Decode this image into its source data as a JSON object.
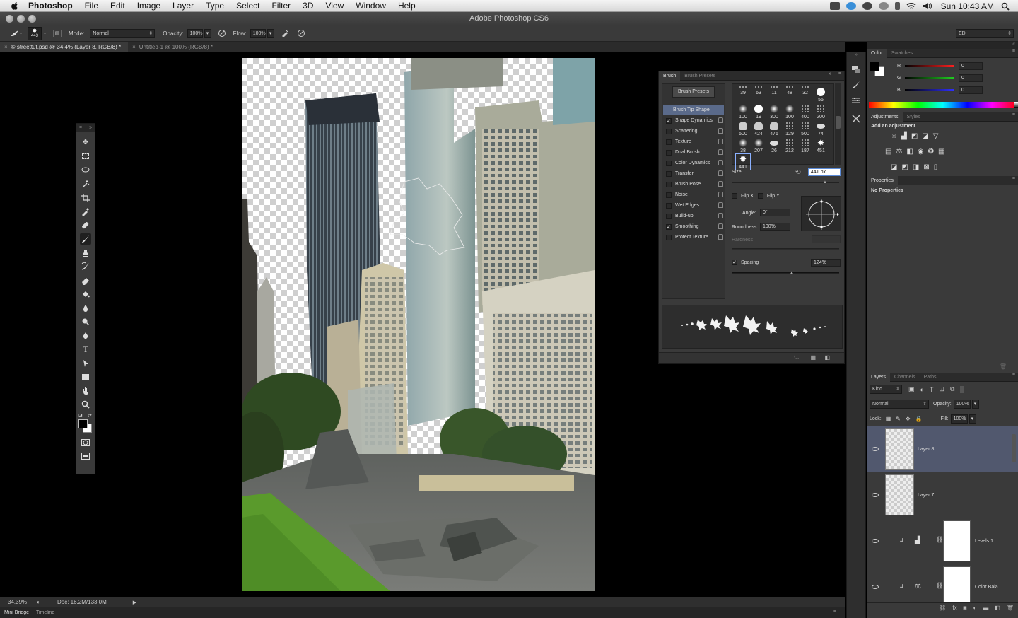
{
  "menubar": {
    "app": "Photoshop",
    "items": [
      "File",
      "Edit",
      "Image",
      "Layer",
      "Type",
      "Select",
      "Filter",
      "3D",
      "View",
      "Window",
      "Help"
    ],
    "clock": "Sun 10:43 AM"
  },
  "titlebar": {
    "title": "Adobe Photoshop CS6"
  },
  "options": {
    "brush_size": "443",
    "mode_label": "Mode:",
    "mode_value": "Normal",
    "opacity_label": "Opacity:",
    "opacity_value": "100%",
    "flow_label": "Flow:",
    "flow_value": "100%",
    "workspace": "ED"
  },
  "doc_tabs": [
    {
      "label": "streettut.psd @ 34.4% (Layer 8, RGB/8) *",
      "prefix": "©"
    },
    {
      "label": "Untitled-1 @ 100% (RGB/8) *"
    }
  ],
  "status": {
    "zoom": "34.39%",
    "doc": "Doc: 16.2M/133.0M"
  },
  "bottom_tabs": [
    "Mini Bridge",
    "Timeline"
  ],
  "brush_panel": {
    "tabs": [
      "Brush",
      "Brush Presets"
    ],
    "presets_button": "Brush Presets",
    "options": [
      {
        "label": "Brush Tip Shape",
        "checked": false,
        "active": true,
        "lock": false
      },
      {
        "label": "Shape Dynamics",
        "checked": true,
        "lock": true
      },
      {
        "label": "Scattering",
        "checked": false,
        "lock": true
      },
      {
        "label": "Texture",
        "checked": false,
        "lock": true
      },
      {
        "label": "Dual Brush",
        "checked": false,
        "lock": true
      },
      {
        "label": "Color Dynamics",
        "checked": false,
        "lock": true
      },
      {
        "label": "Transfer",
        "checked": false,
        "lock": true
      },
      {
        "label": "Brush Pose",
        "checked": false,
        "lock": true
      },
      {
        "label": "Noise",
        "checked": false,
        "lock": true
      },
      {
        "label": "Wet Edges",
        "checked": false,
        "lock": true
      },
      {
        "label": "Build-up",
        "checked": false,
        "lock": true
      },
      {
        "label": "Smoothing",
        "checked": true,
        "lock": true
      },
      {
        "label": "Protect Texture",
        "checked": false,
        "lock": true
      }
    ],
    "tips": [
      [
        "39",
        "63",
        "11",
        "48",
        "32"
      ],
      [
        "55",
        "100",
        "19",
        "300",
        "100"
      ],
      [
        "400",
        "200",
        "500",
        "424",
        "476"
      ],
      [
        "129",
        "500",
        "74",
        "38",
        "207"
      ],
      [
        "26",
        "212",
        "187",
        "451",
        "441"
      ]
    ],
    "size_label": "Size",
    "size_value": "441 px",
    "flipx": "Flip X",
    "flipy": "Flip Y",
    "angle_label": "Angle:",
    "angle_value": "0°",
    "roundness_label": "Roundness:",
    "roundness_value": "100%",
    "hardness_label": "Hardness",
    "spacing_label": "Spacing",
    "spacing_value": "124%"
  },
  "color_panel": {
    "tabs": [
      "Color",
      "Swatches"
    ],
    "channels": [
      {
        "label": "R",
        "value": "0",
        "color": "#ff2020"
      },
      {
        "label": "G",
        "value": "0",
        "color": "#20d020"
      },
      {
        "label": "B",
        "value": "0",
        "color": "#3030ff"
      }
    ]
  },
  "adjust_panel": {
    "tabs": [
      "Adjustments",
      "Styles"
    ],
    "title": "Add an adjustment"
  },
  "properties_panel": {
    "tabs": [
      "Properties"
    ],
    "text": "No Properties"
  },
  "layers_panel": {
    "tabs": [
      "Layers",
      "Channels",
      "Paths"
    ],
    "filter": "Kind",
    "blend": "Normal",
    "opacity_label": "Opacity:",
    "opacity_value": "100%",
    "lock_label": "Lock:",
    "fill_label": "Fill:",
    "fill_value": "100%",
    "layers": [
      {
        "name": "Layer 8",
        "selected": true,
        "type": "pixel"
      },
      {
        "name": "Layer 7",
        "selected": false,
        "type": "pixel"
      },
      {
        "name": "Levels 1",
        "selected": false,
        "type": "adjust"
      },
      {
        "name": "Color Bala...",
        "selected": false,
        "type": "adjust"
      }
    ]
  }
}
